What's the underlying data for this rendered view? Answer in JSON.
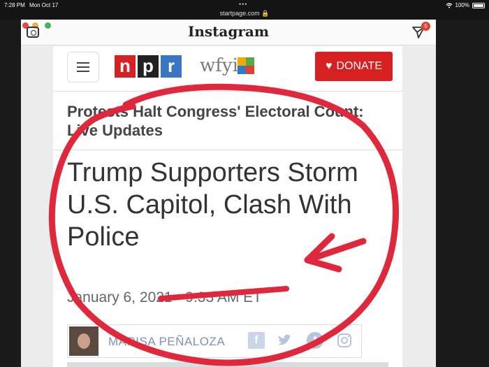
{
  "status_bar": {
    "time": "7:28 PM",
    "date": "Mon Oct 17",
    "url": "startpage.com",
    "battery": "100%"
  },
  "instagram": {
    "title": "Instagram",
    "badge_count": "5"
  },
  "npr": {
    "logo_letters": [
      "n",
      "p",
      "r"
    ],
    "station": "wfyi",
    "donate_label": "DONATE"
  },
  "article": {
    "section_title": "Protests Halt Congress' Electoral Count: Live Updates",
    "headline": "Trump Supporters Storm U.S. Capitol, Clash With Police",
    "date": "January 6, 2021",
    "separator": "·",
    "time": "9:33 AM ET",
    "author": "MARISA PEÑALOZA"
  },
  "colors": {
    "npr_red": "#d62021",
    "npr_black": "#222222",
    "npr_blue": "#3a76c4",
    "annotation_red": "#e0283c"
  }
}
